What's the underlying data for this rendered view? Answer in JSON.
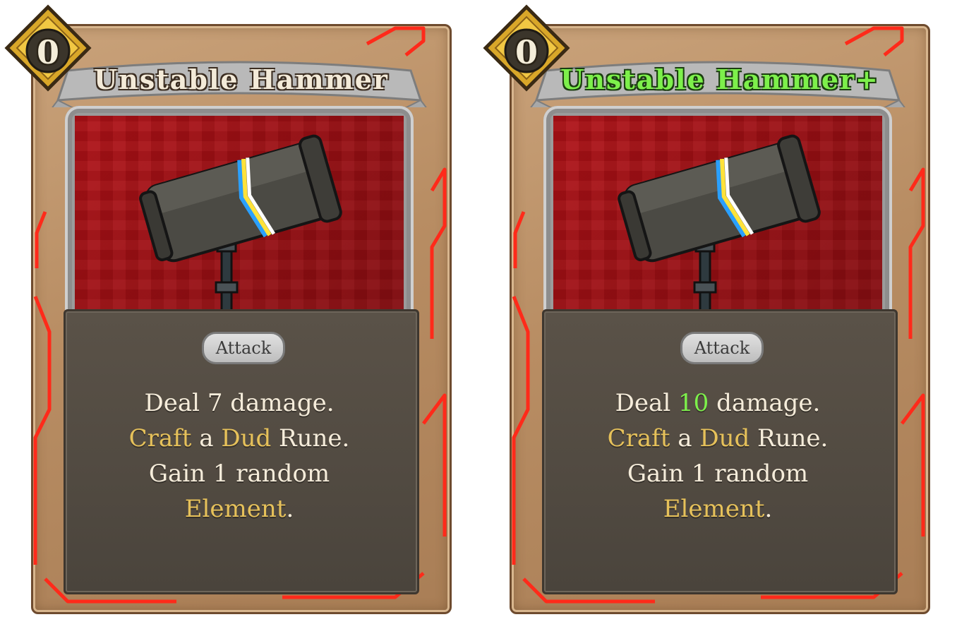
{
  "cards": [
    {
      "cost": "0",
      "title": "Unstable Hammer",
      "type": "Attack",
      "description": {
        "line1_a": "Deal ",
        "line1_value": "7",
        "line1_b": " damage.",
        "line2_kw1": "Craft",
        "line2_mid": " a ",
        "line2_kw2": "Dud",
        "line2_end": " Rune.",
        "line3": "Gain 1 random",
        "line4_kw": "Element",
        "line4_end": "."
      },
      "upgraded": false
    },
    {
      "cost": "0",
      "title": "Unstable Hammer+",
      "type": "Attack",
      "description": {
        "line1_a": "Deal ",
        "line1_value": "10",
        "line1_b": " damage.",
        "line2_kw1": "Craft",
        "line2_mid": " a ",
        "line2_kw2": "Dud",
        "line2_end": " Rune.",
        "line3": "Gain 1 random",
        "line4_kw": "Element",
        "line4_end": "."
      },
      "upgraded": true
    }
  ],
  "colors": {
    "keyword": "#e6c15a",
    "upgraded": "#7df04b",
    "art_background": "#b01116",
    "circuit": "#ff2a1a"
  },
  "icons": {
    "cost_gem": "gold-diamond-gem",
    "art": "hammer-glitch-art"
  }
}
